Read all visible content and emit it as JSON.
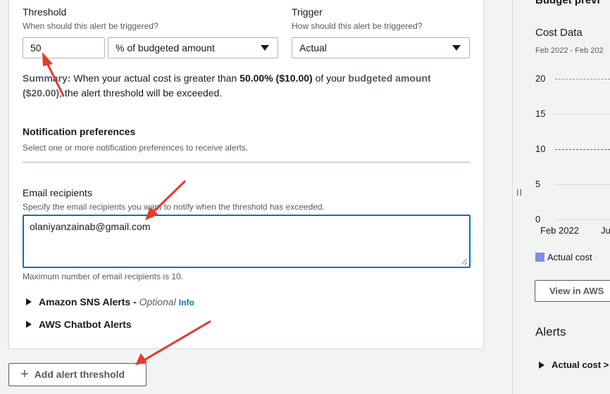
{
  "threshold": {
    "label": "Threshold",
    "description": "When should this alert be triggered?",
    "value": "50",
    "unit_selected": "% of budgeted amount"
  },
  "trigger": {
    "label": "Trigger",
    "description": "How should this alert be triggered?",
    "selected": "Actual"
  },
  "summary": {
    "prefix": "Summary:",
    "text1": " When your actual cost is greater than ",
    "percent": "50.00% ($10.00)",
    "text2": " of your ",
    "budgeted": "budgeted amount ($20.00)",
    "text3": ", the alert threshold will be exceeded."
  },
  "notification": {
    "heading": "Notification preferences",
    "description": "Select one or more notification preferences to receive alerts."
  },
  "email": {
    "label": "Email recipients",
    "description": "Specify the email recipients you want to notify when the threshold has exceeded.",
    "value": "olaniyanzainab@gmail.com",
    "hint": "Maximum number of email recipients is 10."
  },
  "expanders": {
    "sns_label": "Amazon SNS Alerts - ",
    "sns_optional": "Optional",
    "sns_info": "Info",
    "chatbot_label": "AWS Chatbot Alerts"
  },
  "add_threshold_label": "Add alert threshold",
  "right_panel": {
    "title": "Budget previ",
    "cost_title": "Cost Data",
    "date_range": "Feb 2022 - Feb 202",
    "y_ticks": [
      "20",
      "15",
      "10",
      "5",
      "0"
    ],
    "x_ticks": [
      "Feb 2022",
      "Ju"
    ],
    "legend_actual": "Actual cost",
    "view_button": "View in AWS",
    "alerts_heading": "Alerts",
    "alert_item": "Actual cost >"
  },
  "colors": {
    "focus_blue": "#0073bb",
    "annotation_red": "#e8392d",
    "actual_cost_swatch": "#7f8cf0",
    "budget_line": "#d13212"
  }
}
